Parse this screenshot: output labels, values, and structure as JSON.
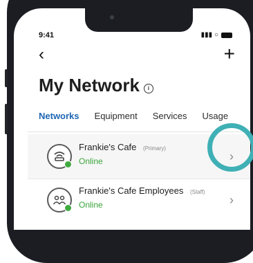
{
  "status_bar": {
    "time": "9:41",
    "signal": "▮▮▮ ○"
  },
  "nav": {
    "back_glyph": "‹",
    "add_glyph": "+"
  },
  "page": {
    "title": "My Network",
    "info_glyph": "i"
  },
  "tabs": [
    {
      "label": "Networks",
      "active": true
    },
    {
      "label": "Equipment",
      "active": false
    },
    {
      "label": "Services",
      "active": false
    },
    {
      "label": "Usage",
      "active": false
    }
  ],
  "networks": [
    {
      "name": "Frankie's Cafe",
      "tag": "(Primary)",
      "status": "Online",
      "icon": "router-wifi-icon"
    },
    {
      "name": "Frankie's Cafe Employees",
      "tag": "(Staff)",
      "status": "Online",
      "icon": "group-users-icon"
    }
  ],
  "chevron_glyph": "›",
  "colors": {
    "accent_tab": "#1e66b5",
    "online_green": "#3aa53a",
    "highlight_ring": "#3fb0b5"
  }
}
